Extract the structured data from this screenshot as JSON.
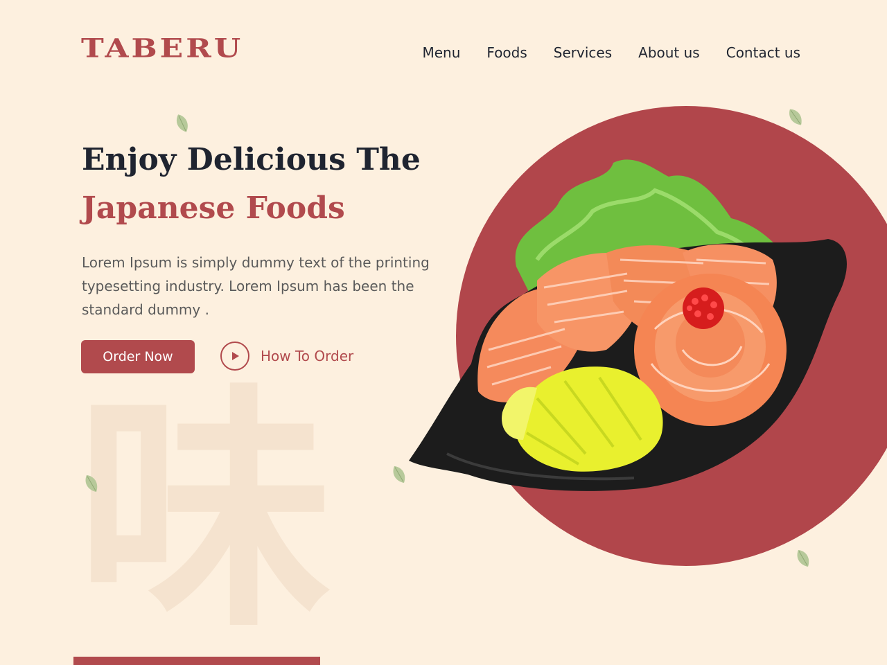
{
  "brand": {
    "logo_text": "TABERU",
    "accent_color": "#b14a4d",
    "background_color": "#fdf0df"
  },
  "nav": {
    "items": [
      "Menu",
      "Foods",
      "Services",
      "About us",
      "Contact us"
    ]
  },
  "hero": {
    "headline_line1": "Enjoy Delicious The",
    "headline_line2": "Japanese Foods",
    "description": "Lorem Ipsum is simply dummy text of the printing typesetting industry. Lorem Ipsum has been the standard dummy .",
    "order_button_label": "Order Now",
    "how_to_label": "How To Order",
    "background_glyph": "味",
    "play_icon": "play-icon"
  }
}
